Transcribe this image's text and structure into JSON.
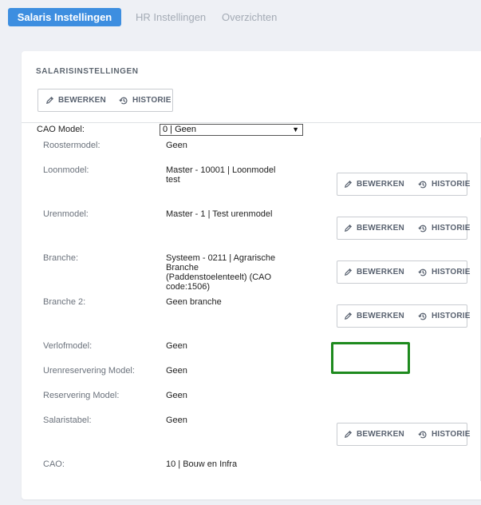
{
  "tabs": [
    {
      "label": "Salaris Instellingen"
    },
    {
      "label": "HR Instellingen"
    },
    {
      "label": "Overzichten"
    }
  ],
  "card": {
    "title": "SALARISINSTELLINGEN",
    "edit_label": "BEWERKEN",
    "history_label": "HISTORIE"
  },
  "cao_model": {
    "label": "CAO Model:",
    "selected": "0 | Geen"
  },
  "fields": [
    {
      "label": "Roostermodel:",
      "value": "Geen"
    },
    {
      "label": "Loonmodel:",
      "value": "Master - 10001 | Loonmodel test"
    },
    {
      "label": "Urenmodel:",
      "value": "Master - 1 | Test urenmodel"
    },
    {
      "label": "Branche:",
      "value": "Systeem - 0211 | Agrarische Branche (Paddenstoelenteelt) (CAO code:1506)"
    },
    {
      "label": "Branche 2:",
      "value": "Geen branche"
    },
    {
      "label": "Verlofmodel:",
      "value": "Geen"
    },
    {
      "label": "Urenreservering Model:",
      "value": "Geen"
    },
    {
      "label": "Reservering Model:",
      "value": "Geen"
    },
    {
      "label": "Salaristabel:",
      "value": "Geen"
    },
    {
      "label": "CAO:",
      "value": "10 | Bouw en Infra"
    }
  ],
  "colors": {
    "primary": "#3d8ee0",
    "highlight": "#1e8a1e",
    "background": "#eef0f5"
  },
  "icons": [
    "pencil-icon",
    "history-icon",
    "chevron-down-icon"
  ]
}
